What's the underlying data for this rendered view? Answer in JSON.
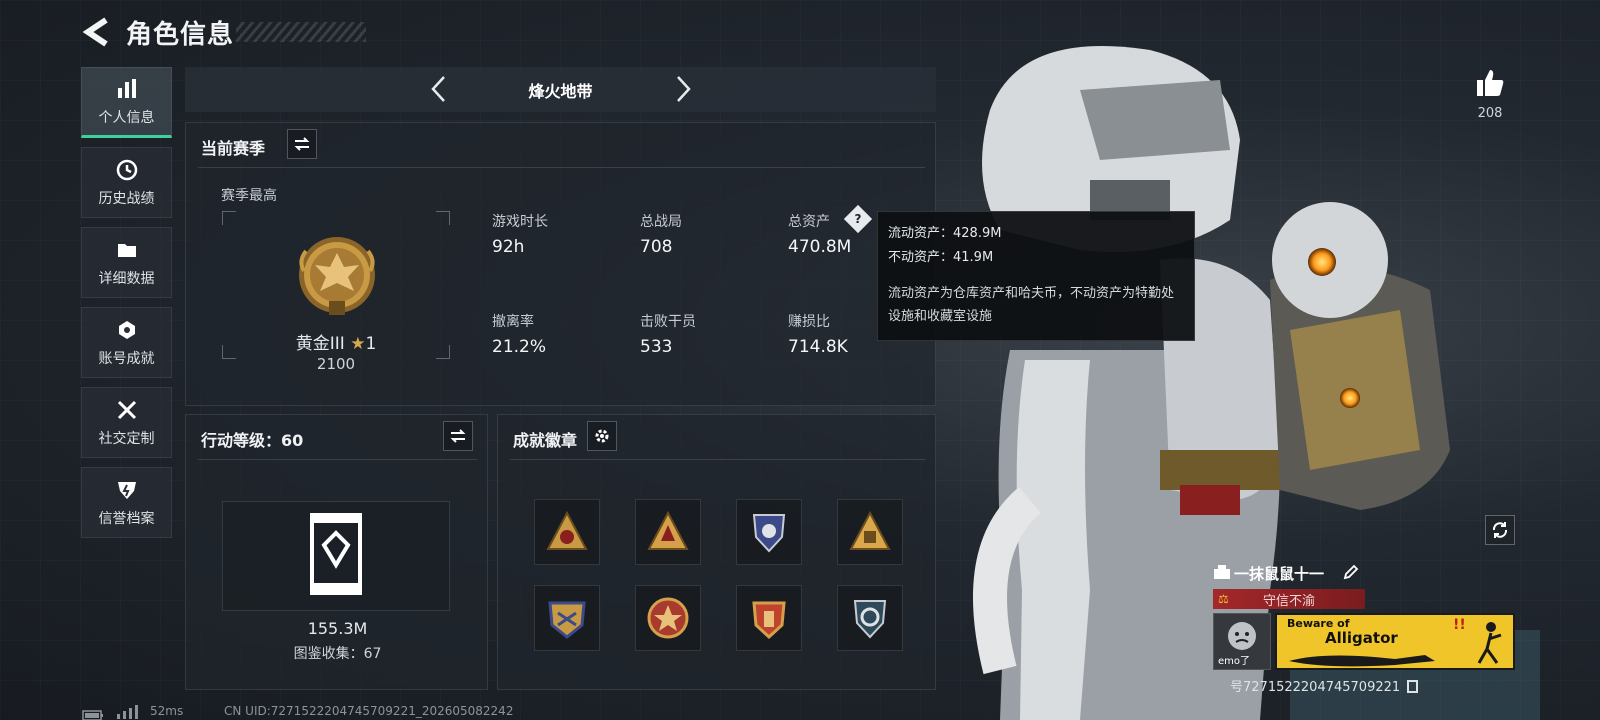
{
  "header": {
    "title": "角色信息"
  },
  "sidebar": {
    "items": [
      {
        "label": "个人信息",
        "icon": "bar-chart-icon",
        "active": true
      },
      {
        "label": "历史战绩",
        "icon": "history-clock-icon",
        "active": false
      },
      {
        "label": "详细数据",
        "icon": "folder-icon",
        "active": false
      },
      {
        "label": "账号成就",
        "icon": "achievement-icon",
        "active": false
      },
      {
        "label": "社交定制",
        "icon": "tools-icon",
        "active": false
      },
      {
        "label": "信誉档案",
        "icon": "shield-emblem-icon",
        "active": false
      }
    ]
  },
  "mode_tab": {
    "title": "烽火地带"
  },
  "season": {
    "title": "当前赛季",
    "best_label": "赛季最高",
    "rank_name": "黄金III",
    "rank_stars": "1",
    "rank_score": "2100",
    "stats": [
      {
        "label": "游戏时长",
        "value": "92h"
      },
      {
        "label": "总战局",
        "value": "708"
      },
      {
        "label": "总资产",
        "value": "470.8M"
      },
      {
        "label": "撤离率",
        "value": "21.2%"
      },
      {
        "label": "击败干员",
        "value": "533"
      },
      {
        "label": "赚损比",
        "value": "714.8K"
      }
    ]
  },
  "tooltip": {
    "liquid": "流动资产：428.9M",
    "fixed": "不动资产：41.9M",
    "description": "流动资产为仓库资产和哈夫币，不动资产为特勤处设施和收藏室设施"
  },
  "action": {
    "title": "行动等级：60",
    "value": "155.3M",
    "collection": "图鉴收集：67"
  },
  "badges": {
    "title": "成就徽章",
    "items": [
      "badge-1",
      "badge-2",
      "badge-3",
      "badge-4",
      "badge-5",
      "badge-6",
      "badge-7",
      "badge-8"
    ]
  },
  "right": {
    "like_count": "208",
    "player_name": "一抹鼠鼠十一",
    "reputation": "守信不渝",
    "avatar_label": "emo了",
    "banner_line1": "Beware of",
    "banner_line2": "Alligator",
    "uid": "号7271522204745709221"
  },
  "footer": {
    "ping": "52ms",
    "uid": "CN UID:7271522204745709221_202605082242"
  },
  "colors": {
    "accent_green": "#3fd19a",
    "gold": "#c99a44",
    "reputation_red": "#a3282a",
    "banner_yellow": "#f0c52a"
  }
}
